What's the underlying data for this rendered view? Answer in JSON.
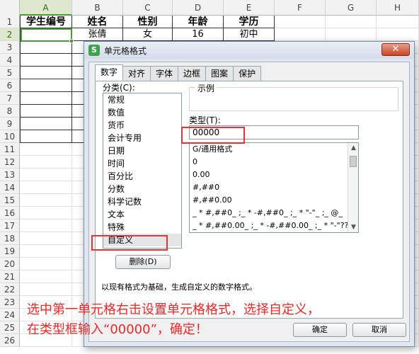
{
  "sheet": {
    "col_labels": [
      "A",
      "B",
      "C",
      "D",
      "E",
      "F",
      "G",
      "H"
    ],
    "row_labels": [
      "1",
      "2",
      "3",
      "4",
      "5",
      "6",
      "7",
      "8",
      "9",
      "10",
      "11",
      "12",
      "13",
      "14",
      "15",
      "16",
      "17",
      "18",
      "19",
      "20",
      "21",
      "22",
      "23",
      "24",
      "25",
      "26"
    ],
    "header_row": [
      "学生编号",
      "姓名",
      "性别",
      "年龄",
      "学历"
    ],
    "data_row": [
      "",
      "张倩",
      "女",
      "16",
      "初中"
    ]
  },
  "dialog": {
    "title": "单元格格式",
    "app_icon": "S",
    "close_icon": "✕",
    "tabs": [
      "数字",
      "对齐",
      "字体",
      "边框",
      "图案",
      "保护"
    ],
    "category_label": "分类(C):",
    "categories": [
      "常规",
      "数值",
      "货币",
      "会计专用",
      "日期",
      "时间",
      "百分比",
      "分数",
      "科学记数",
      "文本",
      "特殊",
      "自定义"
    ],
    "sample_label": "示例",
    "type_label": "类型(T):",
    "type_value": "00000",
    "type_list": [
      "G/通用格式",
      "0",
      "0.00",
      "#,##0",
      "#,##0.00",
      "_ * #,##0_ ;_ * -#,##0_ ;_ * \"-\"_ ;_ @_",
      "_ * #,##0.00_ ;_ * -#,##0.00_ ;_ * \"-\"??_ ;_ @_"
    ],
    "delete_button": "删除(D)",
    "hint": "以现有格式为基础，生成自定义的数字格式。",
    "ok_button": "确定",
    "cancel_button": "取消"
  },
  "instruction": {
    "line1": "选中第一单元格右击设置单元格格式，选择自定义，",
    "line2": "在类型框输入“00000”，确定！"
  },
  "colors": {
    "selection_green": "#4a9a3a",
    "annotation_red": "#e03535"
  }
}
